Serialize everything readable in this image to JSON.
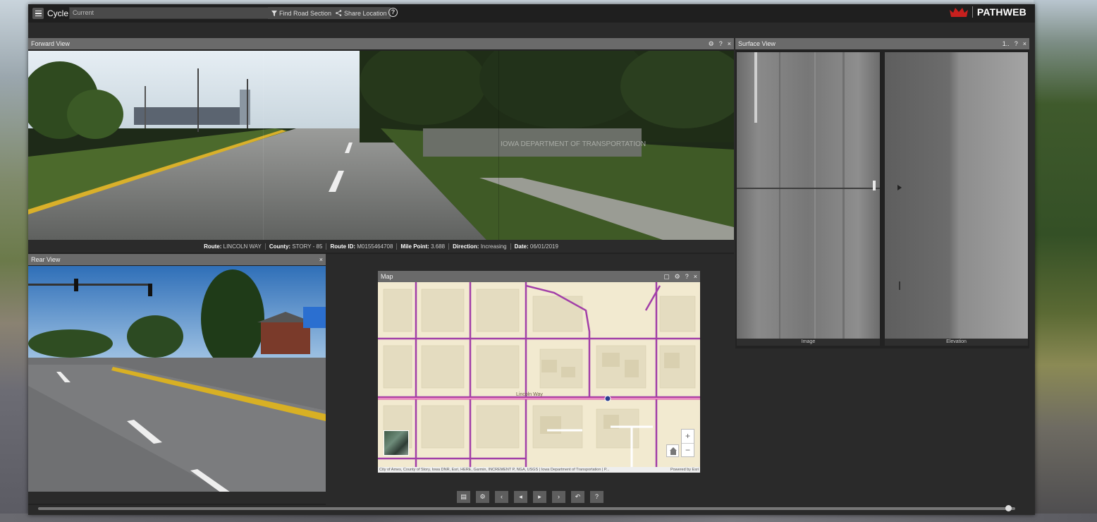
{
  "topbar": {
    "cycle_label": "Cycle",
    "cycle_value": "Current",
    "find_road_label": "Find Road Section",
    "share_label": "Share Location",
    "help_glyph": "?",
    "logo_text": "PATHWEB",
    "icons": [
      "menu-icon",
      "chevron-down-icon",
      "filter-icon",
      "share-icon",
      "help-icon",
      "crown-logo-icon"
    ]
  },
  "forward_view": {
    "title": "Forward View",
    "controls": [
      "⚙",
      "?",
      "×"
    ],
    "info": {
      "route_label": "Route:",
      "route_value": "LINCOLN WAY",
      "county_label": "County:",
      "county_value": "STORY - 85",
      "route_id_label": "Route ID:",
      "route_id_value": "M0155464708",
      "mile_point_label": "Mile Point:",
      "mile_point_value": "3.688",
      "direction_label": "Direction:",
      "direction_value": "Increasing",
      "date_label": "Date:",
      "date_value": "06/01/2019"
    },
    "sign_text": "IOWA DEPARTMENT OF TRANSPORTATION"
  },
  "rear_view": {
    "title": "Rear View",
    "close": "×"
  },
  "surface_view": {
    "title": "Surface View",
    "controls": [
      "1..",
      "?",
      "×"
    ],
    "image_label": "Image",
    "elevation_label": "Elevation"
  },
  "map": {
    "title": "Map",
    "controls": [
      "▢",
      "⚙",
      "?",
      "×"
    ],
    "street_label": "Lincoln Way",
    "zoom_in": "+",
    "zoom_out": "−",
    "attribution": "City of Ames, County of Story, Iowa DNR, Esri, HERE, Garmin, INCREMENT P, NGA, USGS | Iowa Department of Transportation | P...",
    "powered_by": "Powered by Esri"
  },
  "controls_bar": {
    "buttons": [
      {
        "name": "layers-button",
        "glyph": "▤"
      },
      {
        "name": "settings-button",
        "glyph": "⚙"
      },
      {
        "name": "first-button",
        "glyph": "‹"
      },
      {
        "name": "prev-button",
        "glyph": "◂"
      },
      {
        "name": "next-button",
        "glyph": "▸"
      },
      {
        "name": "last-button",
        "glyph": "›"
      },
      {
        "name": "undo-button",
        "glyph": "↶"
      },
      {
        "name": "help-button",
        "glyph": "?"
      }
    ]
  },
  "timeline": {
    "position": 0.993
  },
  "colors": {
    "accent": "#c8201e",
    "panel_header": "#6a6a6a",
    "app_bg": "#2a2a2a",
    "road_purple": "#a23fa8",
    "map_bg": "#f2ead0"
  }
}
